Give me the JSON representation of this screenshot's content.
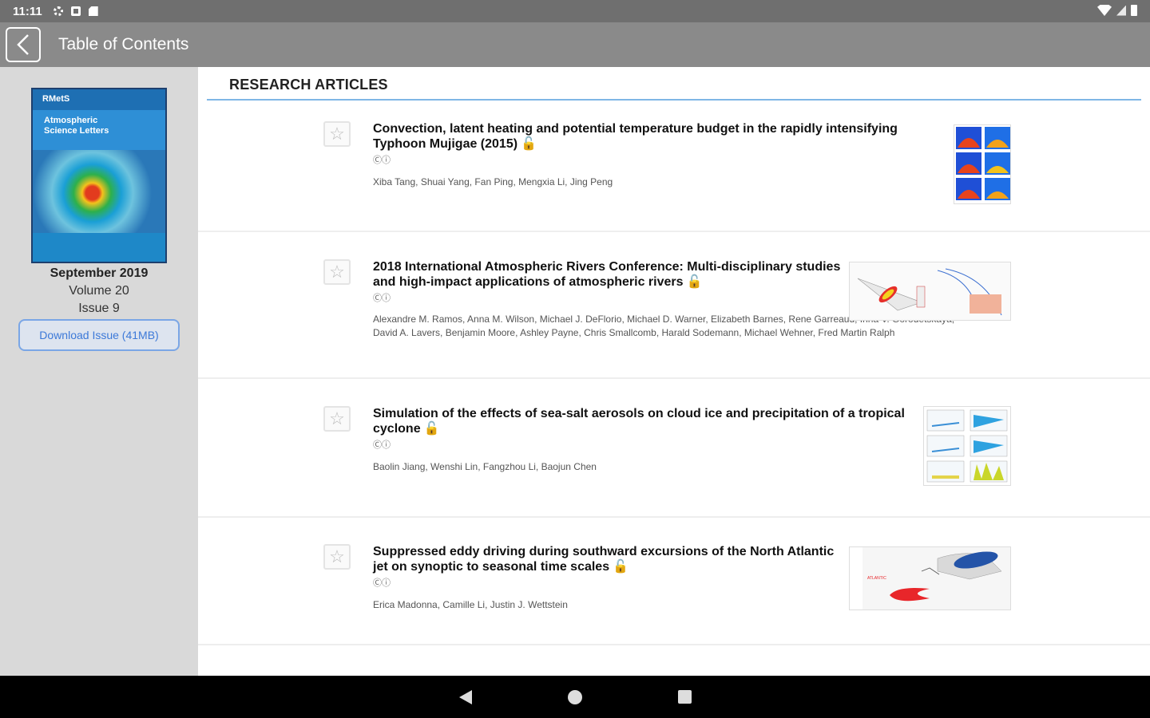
{
  "status_bar": {
    "time": "11:11"
  },
  "app_bar": {
    "title": "Table of Contents"
  },
  "sidebar": {
    "cover": {
      "brand": "RMetS",
      "journal_title": "Atmospheric Science Letters"
    },
    "issue_month": "September 2019",
    "volume": "Volume 20",
    "issue": "Issue 9",
    "download_label": "Download Issue (41MB)"
  },
  "section_header": "RESEARCH ARTICLES",
  "articles": [
    {
      "title": "Convection, latent heating and potential temperature budget in the rapidly intensifying Typhoon Mujigae (2015)",
      "license": "Ⓒⓘ",
      "authors": "Xiba Tang, Shuai Yang, Fan Ping, Mengxia Li, Jing Peng"
    },
    {
      "title": "2018 International Atmospheric Rivers Conference: Multi-disciplinary studies and high-impact applications of atmospheric rivers",
      "license": "Ⓒⓘ",
      "authors": "Alexandre M. Ramos, Anna M. Wilson, Michael J. DeFlorio, Michael D. Warner, Elizabeth Barnes, Rene Garreaud, Irina V. Gorodetskaya, David A. Lavers, Benjamin Moore, Ashley Payne, Chris Smallcomb, Harald Sodemann, Michael Wehner, Fred Martin Ralph"
    },
    {
      "title": "Simulation of the effects of sea-salt aerosols on cloud ice and precipitation of a tropical cyclone",
      "license": "Ⓒⓘ",
      "authors": "Baolin Jiang, Wenshi Lin, Fangzhou Li, Baojun Chen"
    },
    {
      "title": "Suppressed eddy driving during southward excursions of the North Atlantic jet on synoptic to seasonal time scales",
      "license": "Ⓒⓘ",
      "authors": "Erica Madonna, Camille Li, Justin J. Wettstein"
    }
  ],
  "icons": {
    "open_access": "🔓",
    "star": "☆"
  },
  "colors": {
    "accent": "#7fb6e6",
    "download": "#3c79d8",
    "open_access": "#8e5fc7"
  }
}
